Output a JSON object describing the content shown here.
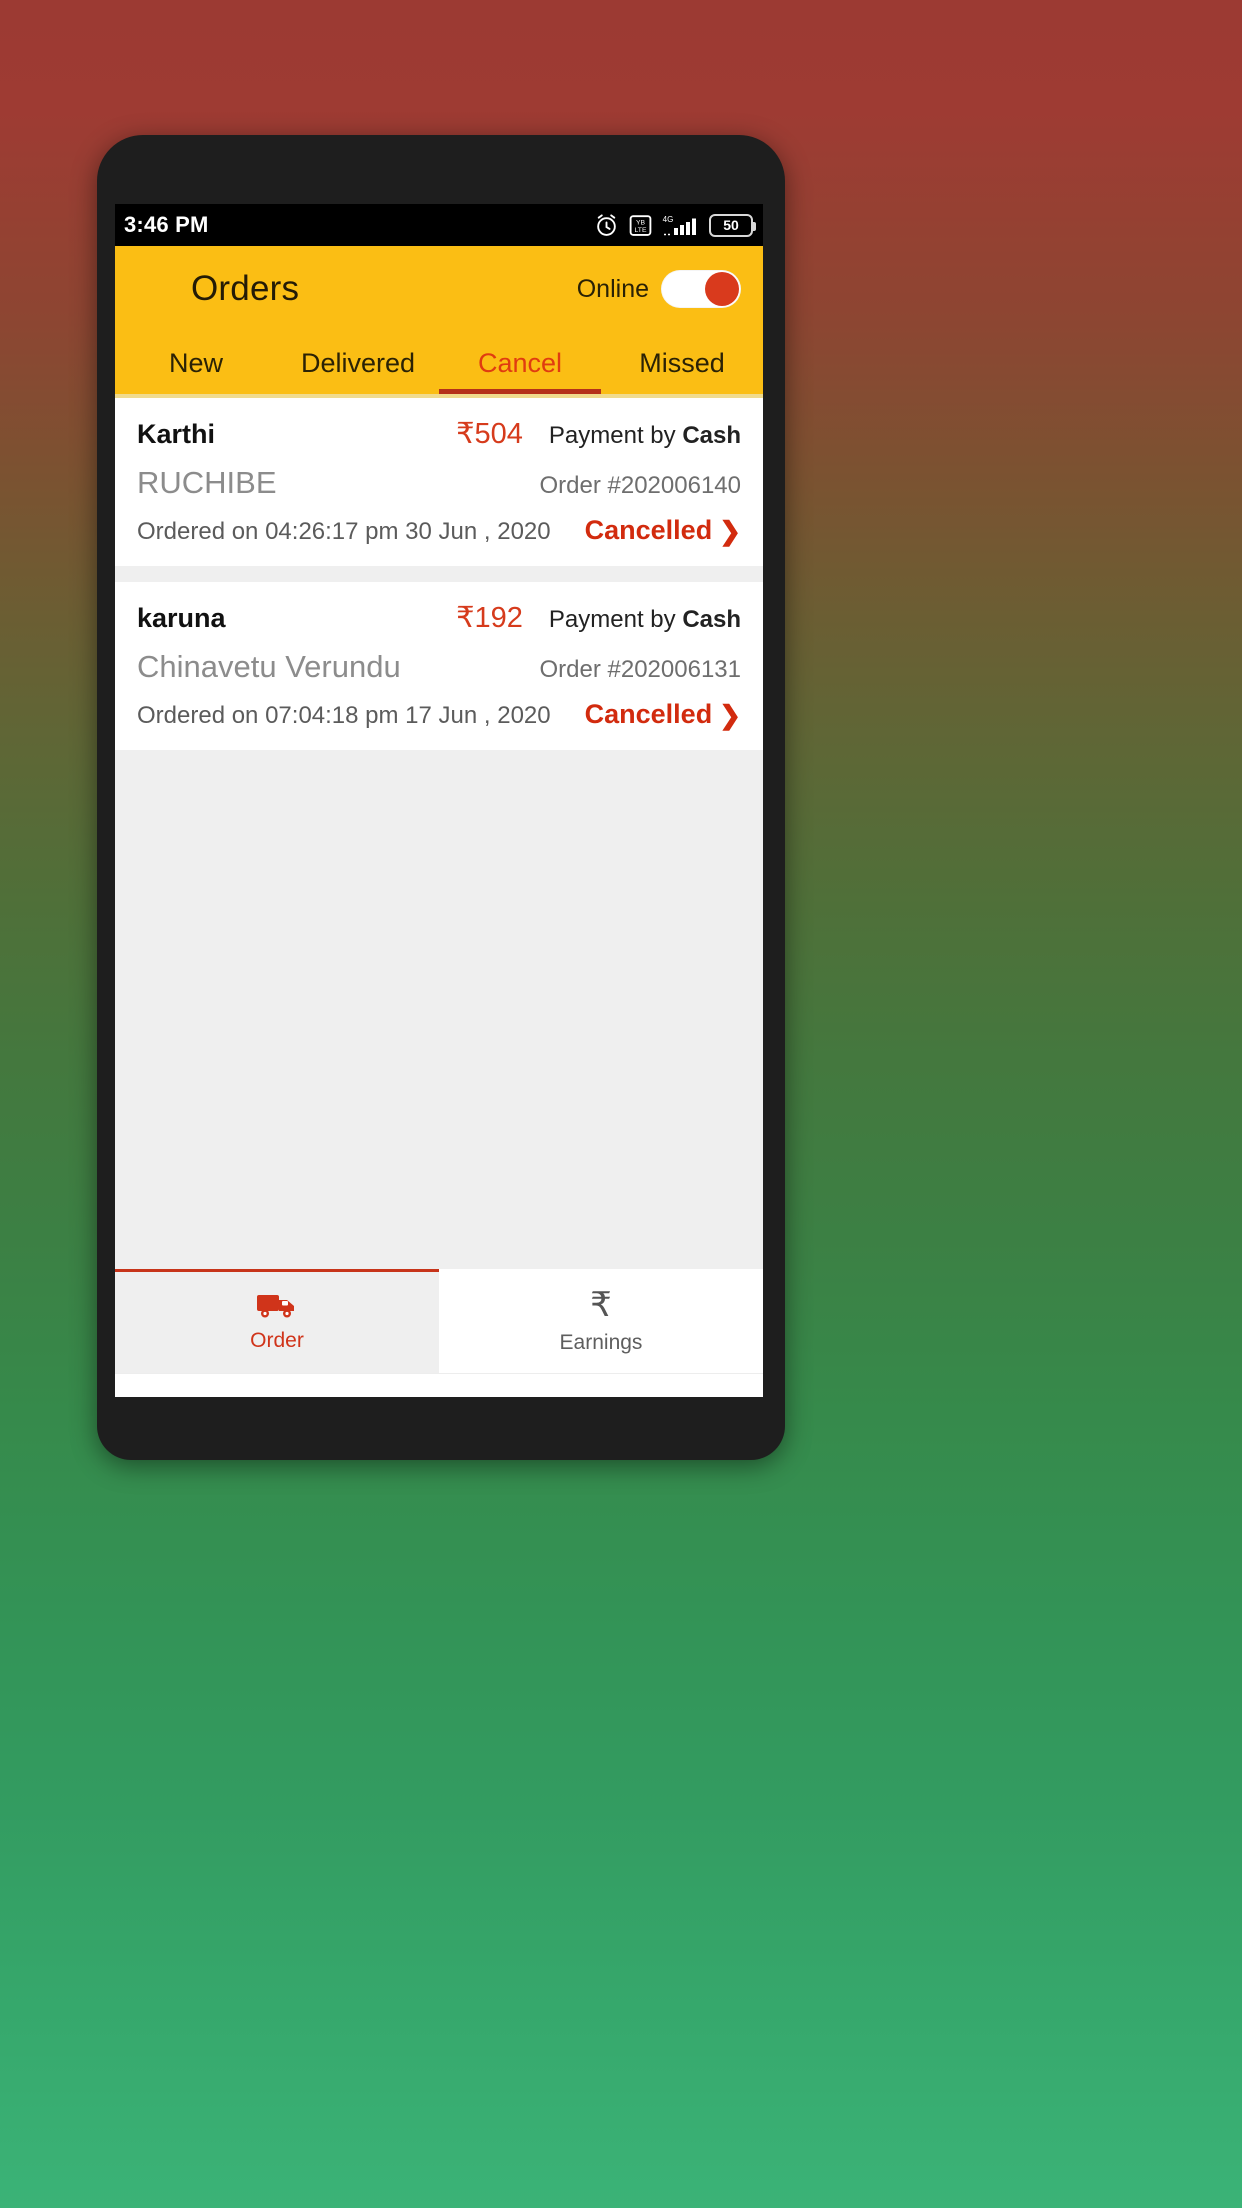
{
  "status_bar": {
    "time": "3:46 PM",
    "icons": [
      "alarm-icon",
      "app-notification-icon",
      "signal-4g-icon"
    ],
    "battery_level": "50"
  },
  "app_bar": {
    "title": "Orders",
    "online_label": "Online",
    "toggle_state": "on",
    "background_color": "#FBBE14",
    "accent_color": "#D93A1D"
  },
  "tabs": [
    {
      "label": "New",
      "active": false
    },
    {
      "label": "Delivered",
      "active": false
    },
    {
      "label": "Cancel",
      "active": true
    },
    {
      "label": "Missed",
      "active": false
    }
  ],
  "orders": [
    {
      "customer": "Karthi",
      "amount": "₹504",
      "payment_prefix": "Payment by ",
      "payment_method": "Cash",
      "shop": "RUCHIBE",
      "order_id": "Order #202006140",
      "ordered_on": "Ordered on 04:26:17 pm 30 Jun , 2020",
      "status": "Cancelled",
      "chevron": "❯"
    },
    {
      "customer": "karuna",
      "amount": "₹192",
      "payment_prefix": "Payment by ",
      "payment_method": "Cash",
      "shop": "Chinavetu Verundu",
      "order_id": "Order #202006131",
      "ordered_on": "Ordered on 07:04:18 pm 17 Jun , 2020",
      "status": "Cancelled",
      "chevron": "❯"
    }
  ],
  "bottom_nav": [
    {
      "label": "Order",
      "icon": "truck-icon",
      "active": true
    },
    {
      "label": "Earnings",
      "icon": "rupee-icon",
      "active": false,
      "glyph": "₹"
    }
  ],
  "android_nav": {
    "recent": "square-recents-icon",
    "home": "circle-home-icon",
    "back": "triangle-back-icon"
  }
}
